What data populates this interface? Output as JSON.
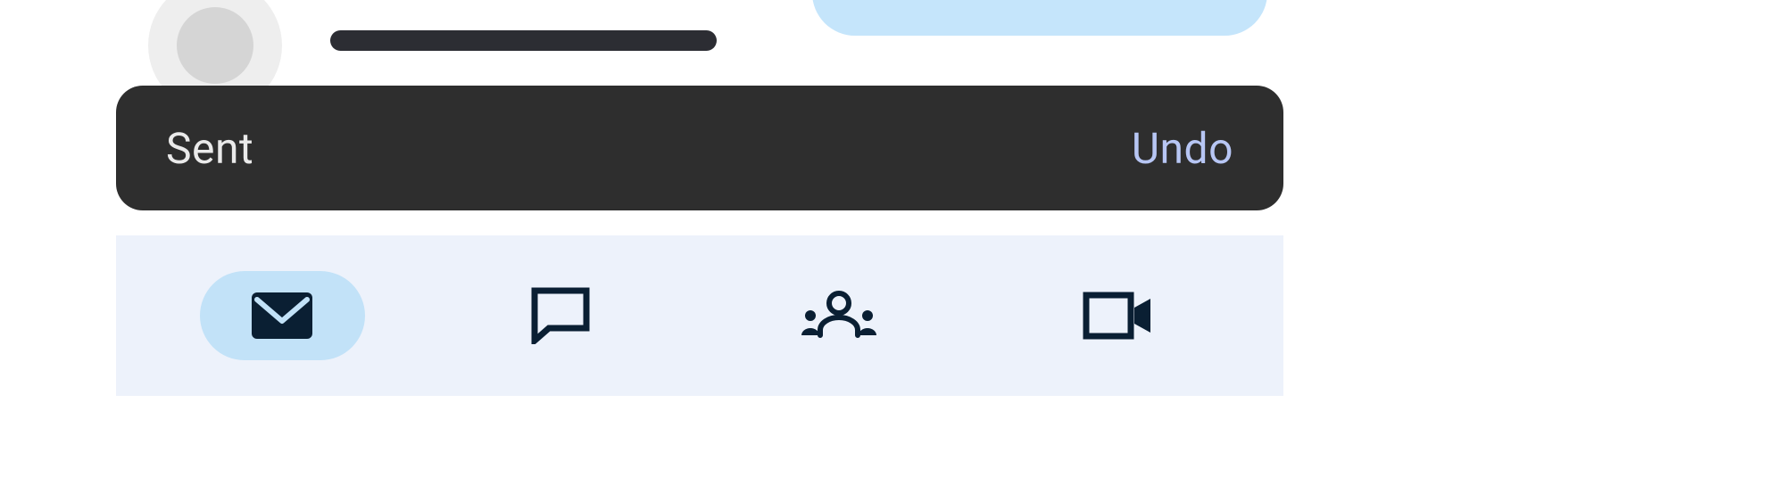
{
  "snackbar": {
    "message": "Sent",
    "action_label": "Undo"
  },
  "nav": {
    "items": [
      {
        "name": "mail",
        "selected": true
      },
      {
        "name": "chat",
        "selected": false
      },
      {
        "name": "spaces",
        "selected": false
      },
      {
        "name": "meet",
        "selected": false
      }
    ]
  },
  "colors": {
    "snackbar_bg": "#2e2e2e",
    "snackbar_text": "#eaeaea",
    "snackbar_action": "#b7c6f4",
    "nav_bg": "#edf2fb",
    "nav_selected_bg": "#c2e2f8",
    "icon_color": "#0a1f33"
  }
}
